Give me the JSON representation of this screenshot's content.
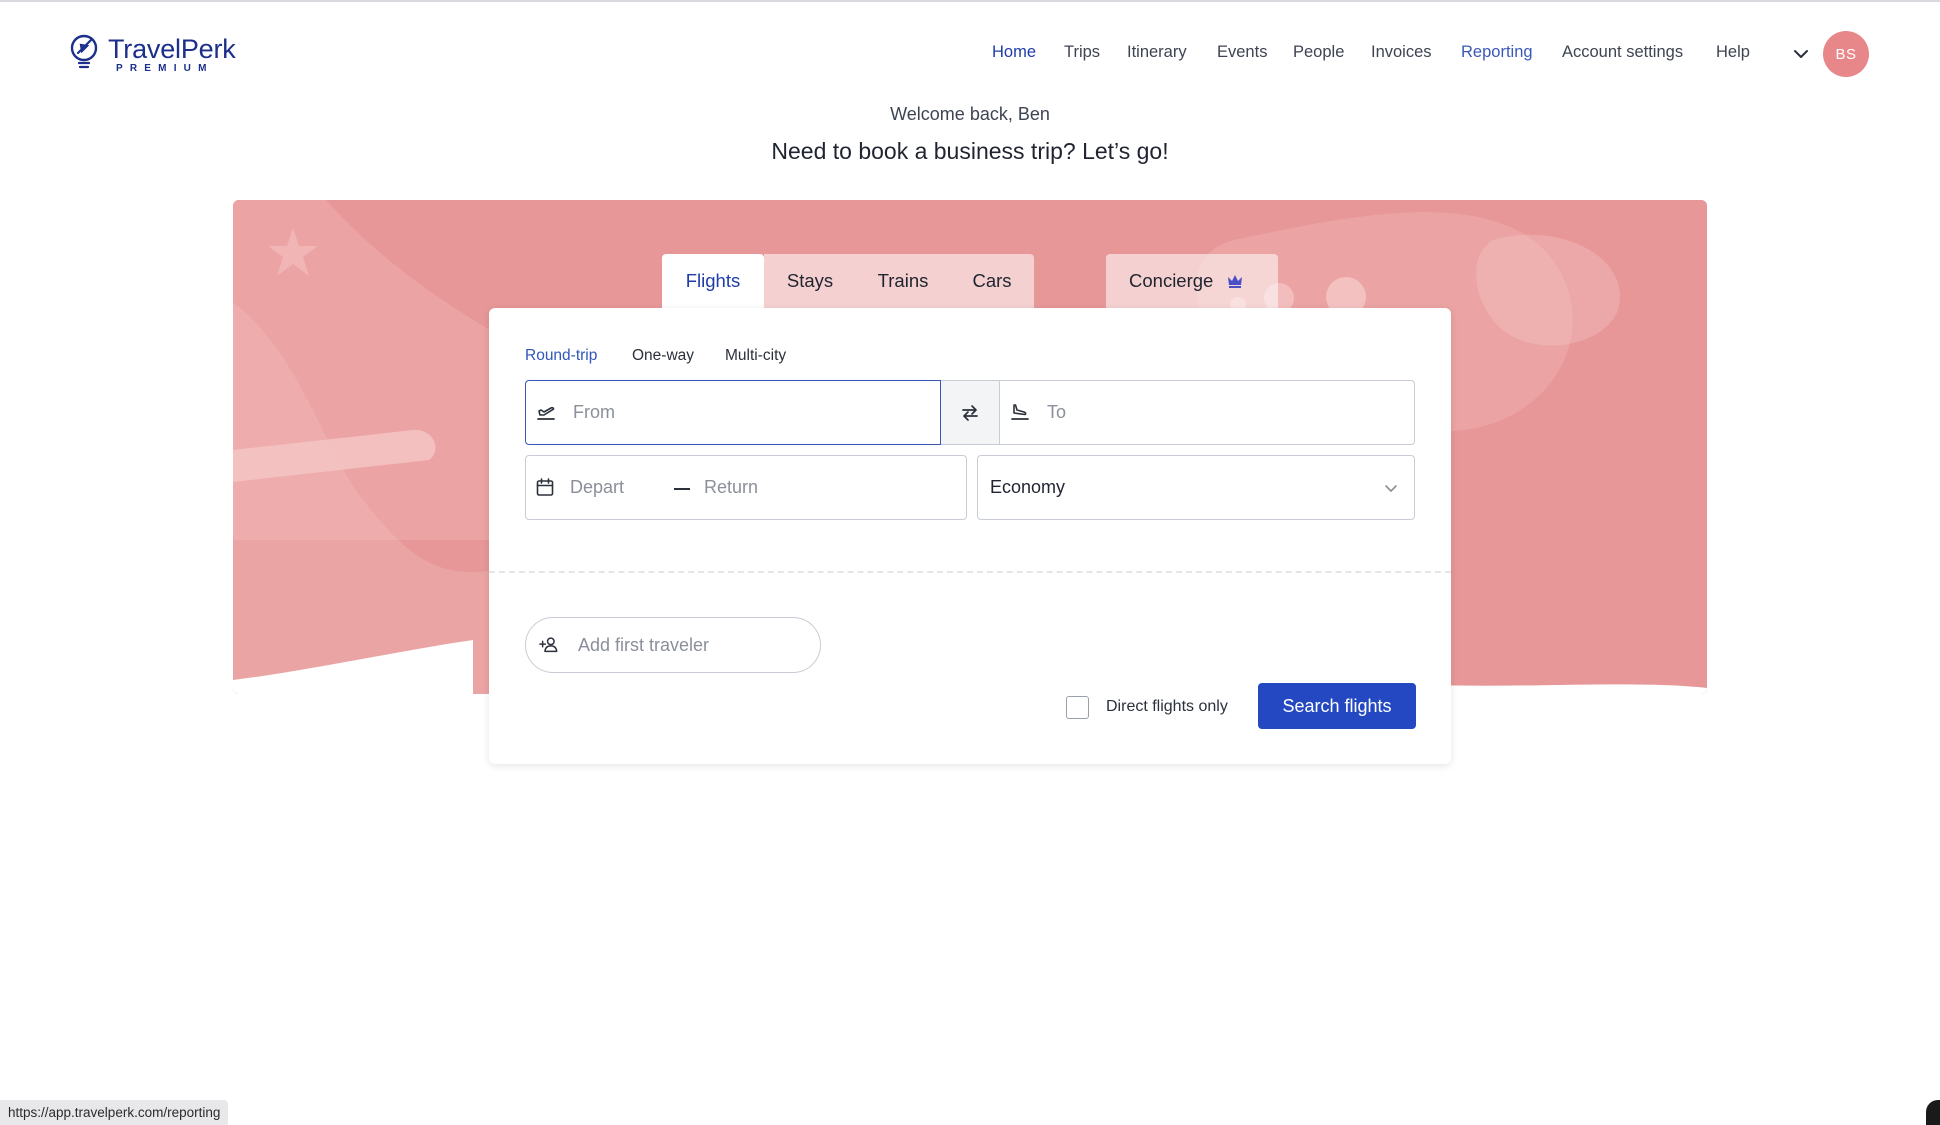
{
  "brand": {
    "name": "TravelPerk",
    "tier": "PREMIUM"
  },
  "nav": {
    "items": [
      {
        "label": "Home",
        "state": "active"
      },
      {
        "label": "Trips",
        "state": ""
      },
      {
        "label": "Itinerary",
        "state": ""
      },
      {
        "label": "Events",
        "state": ""
      },
      {
        "label": "People",
        "state": ""
      },
      {
        "label": "Invoices",
        "state": ""
      },
      {
        "label": "Reporting",
        "state": "hover"
      },
      {
        "label": "Account settings",
        "state": ""
      },
      {
        "label": "Help",
        "state": ""
      }
    ],
    "menu_icon": "chevron-down-icon",
    "avatar_initials": "BS"
  },
  "greeting": {
    "welcome": "Welcome back, Ben",
    "headline": "Need to book a business trip? Let’s go!"
  },
  "booking": {
    "tabs": [
      {
        "label": "Flights",
        "active": true
      },
      {
        "label": "Stays",
        "active": false
      },
      {
        "label": "Trains",
        "active": false
      },
      {
        "label": "Cars",
        "active": false
      }
    ],
    "concierge": {
      "label": "Concierge",
      "icon": "crown-icon"
    },
    "trip_types": [
      {
        "label": "Round-trip",
        "active": true
      },
      {
        "label": "One-way",
        "active": false
      },
      {
        "label": "Multi-city",
        "active": false
      }
    ],
    "from": {
      "placeholder": "From",
      "icon": "takeoff-icon"
    },
    "swap_icon": "swap-arrows-icon",
    "to": {
      "placeholder": "To",
      "icon": "landing-icon"
    },
    "depart": {
      "placeholder": "Depart",
      "icon": "calendar-icon"
    },
    "return": {
      "placeholder": "Return"
    },
    "cabin_class": {
      "value": "Economy",
      "icon": "chevron-down-icon"
    },
    "traveler": {
      "placeholder": "Add first traveler",
      "icon": "add-person-icon"
    },
    "direct_only": {
      "label": "Direct flights only",
      "checked": false
    },
    "search_button": "Search flights"
  },
  "status_url": "https://app.travelperk.com/reporting",
  "colors": {
    "brand_blue": "#1c2f8a",
    "primary_button": "#2348c2",
    "hero_background": "#e99b9b",
    "avatar": "#e8878a"
  }
}
